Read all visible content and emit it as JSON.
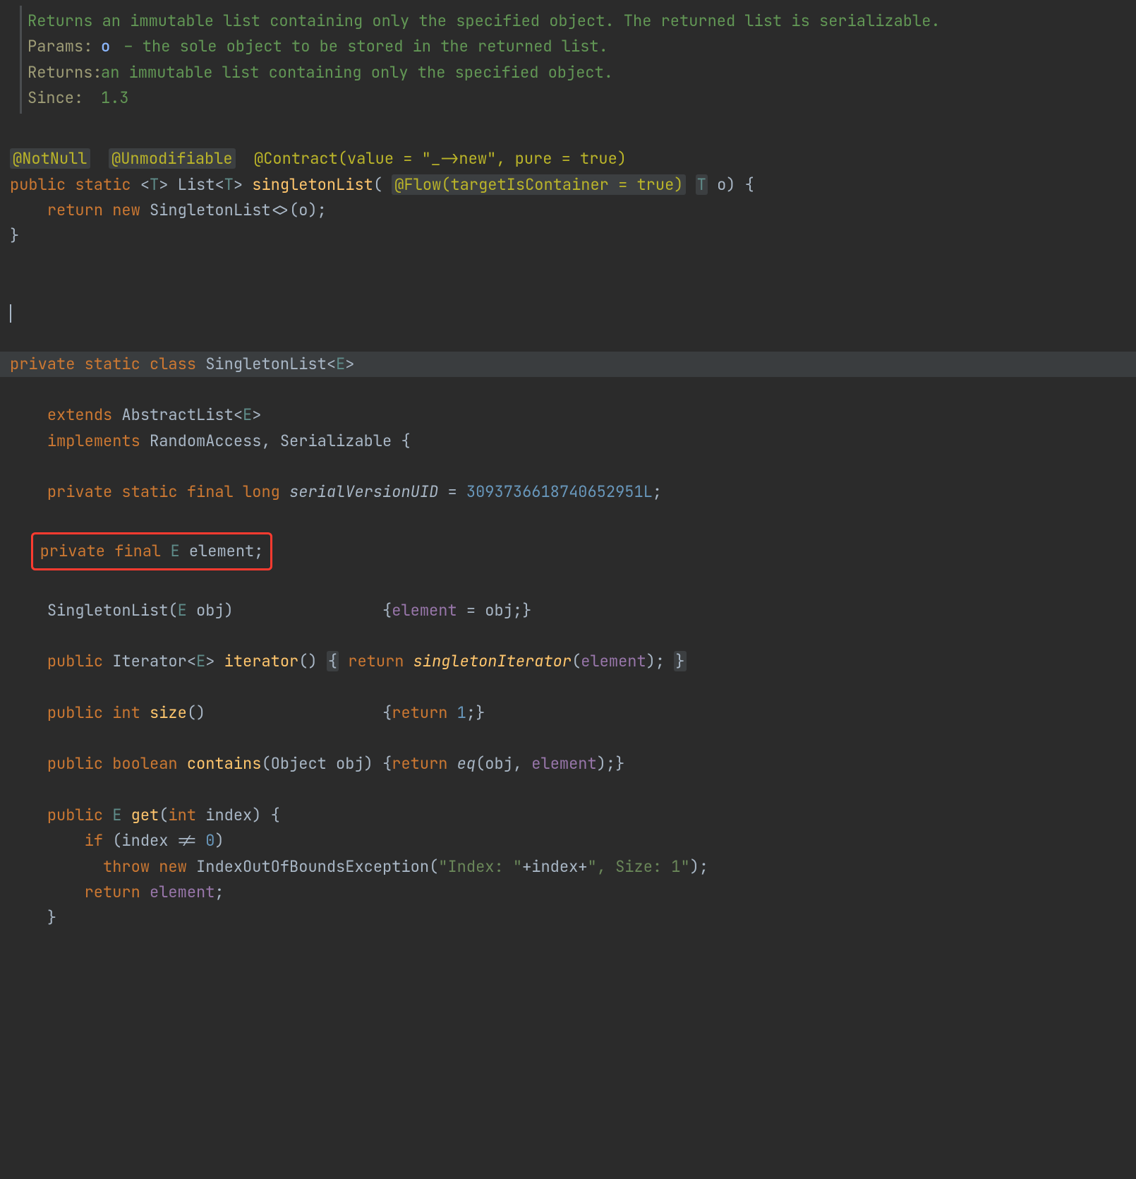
{
  "javadoc": {
    "description": "Returns an immutable list containing only the specified object. The returned list is serializable.",
    "tags": {
      "params_label": "Params:",
      "params_name": "o",
      "params_desc": " – the sole object to be stored in the returned list.",
      "returns_label": "Returns:",
      "returns_desc": "an immutable list containing only the specified object.",
      "since_label": "Since:",
      "since_val": "1.3"
    }
  },
  "ann": {
    "notnull": "@NotNull",
    "unmodifiable": "@Unmodifiable",
    "contract": "@Contract(value = \"_->new\", pure = true)",
    "flow": "@Flow(targetIsContainer = true)"
  },
  "kw": {
    "public": "public",
    "static": "static",
    "return": "return",
    "new": "new",
    "private": "private",
    "class": "class",
    "extends": "extends",
    "implements": "implements",
    "final": "final",
    "long": "long",
    "int": "int",
    "boolean": "boolean",
    "if": "if",
    "throw": "throw"
  },
  "sig": {
    "list": "List",
    "T": "T",
    "singletonList": "singletonList",
    "o": "o",
    "SingletonList": "SingletonList",
    "E": "E",
    "AbstractList": "AbstractList",
    "RandomAccess": "RandomAccess",
    "Serializable": "Serializable",
    "serialVersionUID": "serialVersionUID",
    "serialNum": "3093736618740652951L",
    "element": "element",
    "obj": "obj",
    "Iterator": "Iterator",
    "iterator": "iterator",
    "singletonIterator": "singletonIterator",
    "size": "size",
    "one": "1",
    "zero": "0",
    "contains": "contains",
    "Object": "Object",
    "eq": "eq",
    "get": "get",
    "index": "index",
    "IndexOutOfBoundsException": "IndexOutOfBoundsException",
    "str1": "\"Index: \"",
    "str2": "\", Size: 1\""
  }
}
